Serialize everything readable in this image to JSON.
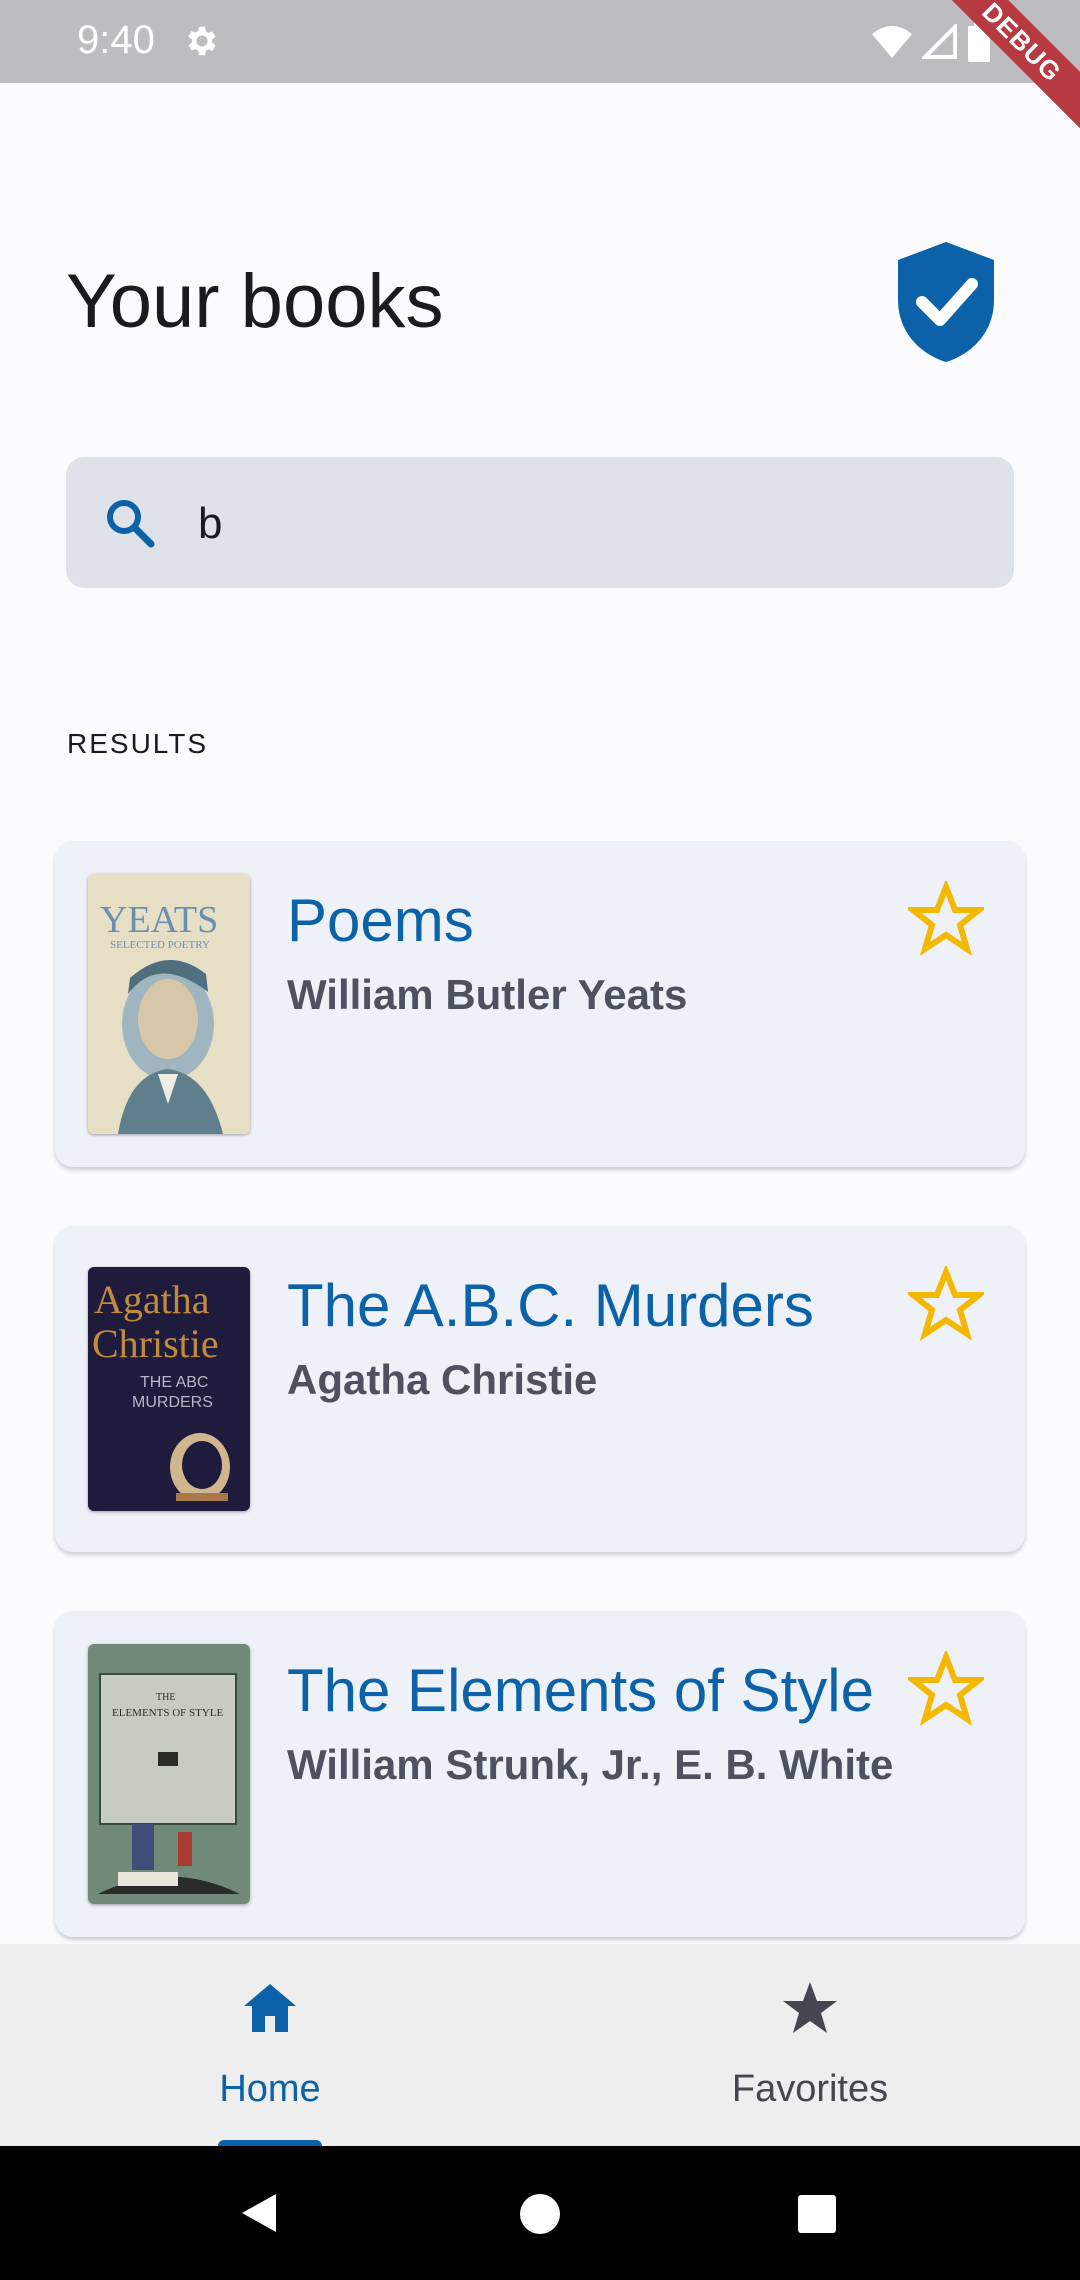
{
  "status_bar": {
    "time": "9:40",
    "debug_label": "DEBUG"
  },
  "header": {
    "title": "Your books"
  },
  "search": {
    "value": "b",
    "placeholder": ""
  },
  "results": {
    "label": "RESULTS",
    "books": [
      {
        "title": "Poems",
        "author": "William Butler Yeats",
        "cover_text_1": "YEATS",
        "cover_text_2": "SELECTED POETRY"
      },
      {
        "title": "The A.B.C. Murders",
        "author": "Agatha Christie",
        "cover_text_1": "Agatha",
        "cover_text_2": "Christie",
        "cover_text_3": "THE ABC",
        "cover_text_4": "MURDERS"
      },
      {
        "title": "The Elements of Style",
        "author": "William Strunk, Jr., E. B. White",
        "cover_text_1": "THE",
        "cover_text_2": "ELEMENTS OF STYLE"
      }
    ]
  },
  "bottom_nav": {
    "items": [
      {
        "label": "Home",
        "icon": "home-icon",
        "active": true
      },
      {
        "label": "Favorites",
        "icon": "star-icon",
        "active": false
      }
    ]
  },
  "colors": {
    "primary": "#0b62a8",
    "star": "#f5b800",
    "card_bg": "#eff1f8",
    "search_bg": "#e0e2ea"
  }
}
